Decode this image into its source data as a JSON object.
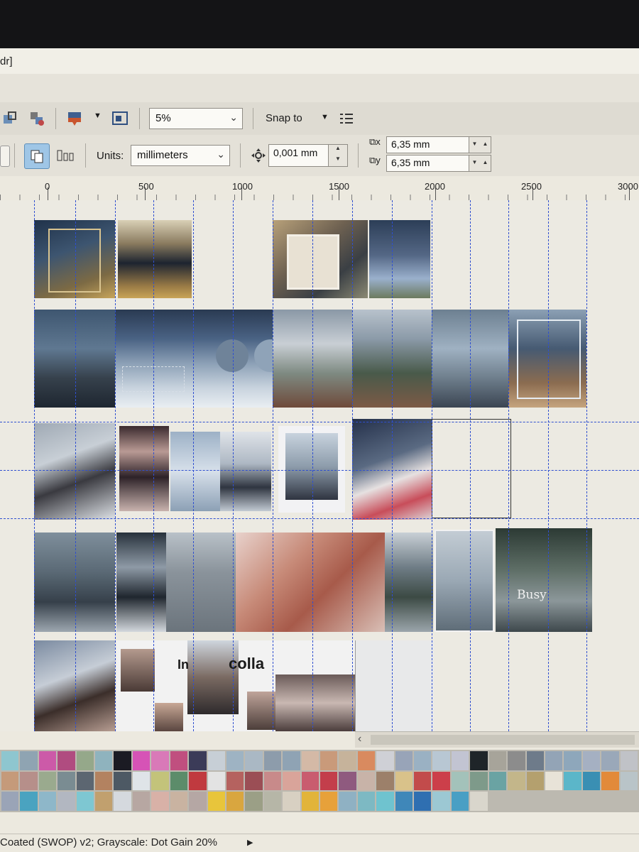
{
  "window": {
    "title_fragment": "dr]"
  },
  "toolbar": {
    "zoom_value": "5%",
    "snap_label": "Snap to",
    "units_label": "Units:",
    "units_value": "millimeters",
    "nudge_value": "0,001 mm",
    "dup_x_value": "6,35 mm",
    "dup_y_value": "6,35 mm"
  },
  "ruler": {
    "ticks": [
      "0",
      "500",
      "1000",
      "1500",
      "2000",
      "2500",
      "3000"
    ]
  },
  "canvas": {
    "row1_text": "",
    "row5_text_in": "In",
    "row5_text_colla": "colla",
    "row4_text_busy": "Busy"
  },
  "status": {
    "color_profile": "Coated (SWOP) v2; Grayscale: Dot Gain 20%"
  },
  "colors": {
    "guide": "#2f4fd0",
    "canvas_bg": "#eceae2",
    "toolbar_bg": "#dedbd2",
    "active_button": "#9fc6e6"
  },
  "palette": [
    "#8ec6cf",
    "#8fa4b2",
    "#cc5aa8",
    "#b04c80",
    "#95a88a",
    "#8fb3be",
    "#1b1b23",
    "#d653b6",
    "#d979b8",
    "#c04f7f",
    "#3b3b58",
    "#c7cfd6",
    "#9eb3c3",
    "#aab8c4",
    "#8d9cab",
    "#8fa3b4",
    "#d4b9a6",
    "#c99a7a",
    "#c6b39b",
    "#d98a5f",
    "#cfd0d6",
    "#98a4b8",
    "#9ab1c3",
    "#b8c7d3",
    "#c2c4d2",
    "#1f2529",
    "#a7a49a",
    "#8c8c8c",
    "#6e7b8a",
    "#93a4b6",
    "#8ea7bb",
    "#a5b0c2",
    "#9aa8b9",
    "#c0c2c7",
    "#c59a7a",
    "#b68f8a",
    "#9aaa8e",
    "#7a8c92",
    "#5c6671",
    "#b38260",
    "#4d5964",
    "#dfe4e8",
    "#c3c37a",
    "#5c8c6a",
    "#c03a3f",
    "#e3e3e3",
    "#b5625f",
    "#9b4e55",
    "#c88a8a",
    "#d9a49a",
    "#c95c6f",
    "#c33e4b",
    "#8f5a7f",
    "#c8b3a8",
    "#9c806a",
    "#d9c28a",
    "#c24b4b",
    "#cc3f4a",
    "#a3c2ba",
    "#7e9a8a",
    "#6aa3a3",
    "#c3b68a",
    "#b4a06e",
    "#e8e3d8",
    "#5bb6c9",
    "#3a8fb3",
    "#e28a3a",
    "#b9c4c8",
    "#9aa4b7",
    "#4aa3c0",
    "#8eb7c9",
    "#b2b7c1",
    "#7ec7d2",
    "#c1a06e",
    "#d5d9de",
    "#b7a7a2",
    "#d8b1a7",
    "#c9b3a1",
    "#b5a7a4",
    "#e8c53b",
    "#d9a63f",
    "#9b9f86",
    "#b6b6a7",
    "#d8d0c2",
    "#e2b43a",
    "#e7a13a",
    "#8fb1c3",
    "#7db9c3",
    "#6fc3cf",
    "#3f87b9",
    "#2f6fb1",
    "#9cc8d3",
    "#4a9fc4",
    "#d9d6cc"
  ]
}
